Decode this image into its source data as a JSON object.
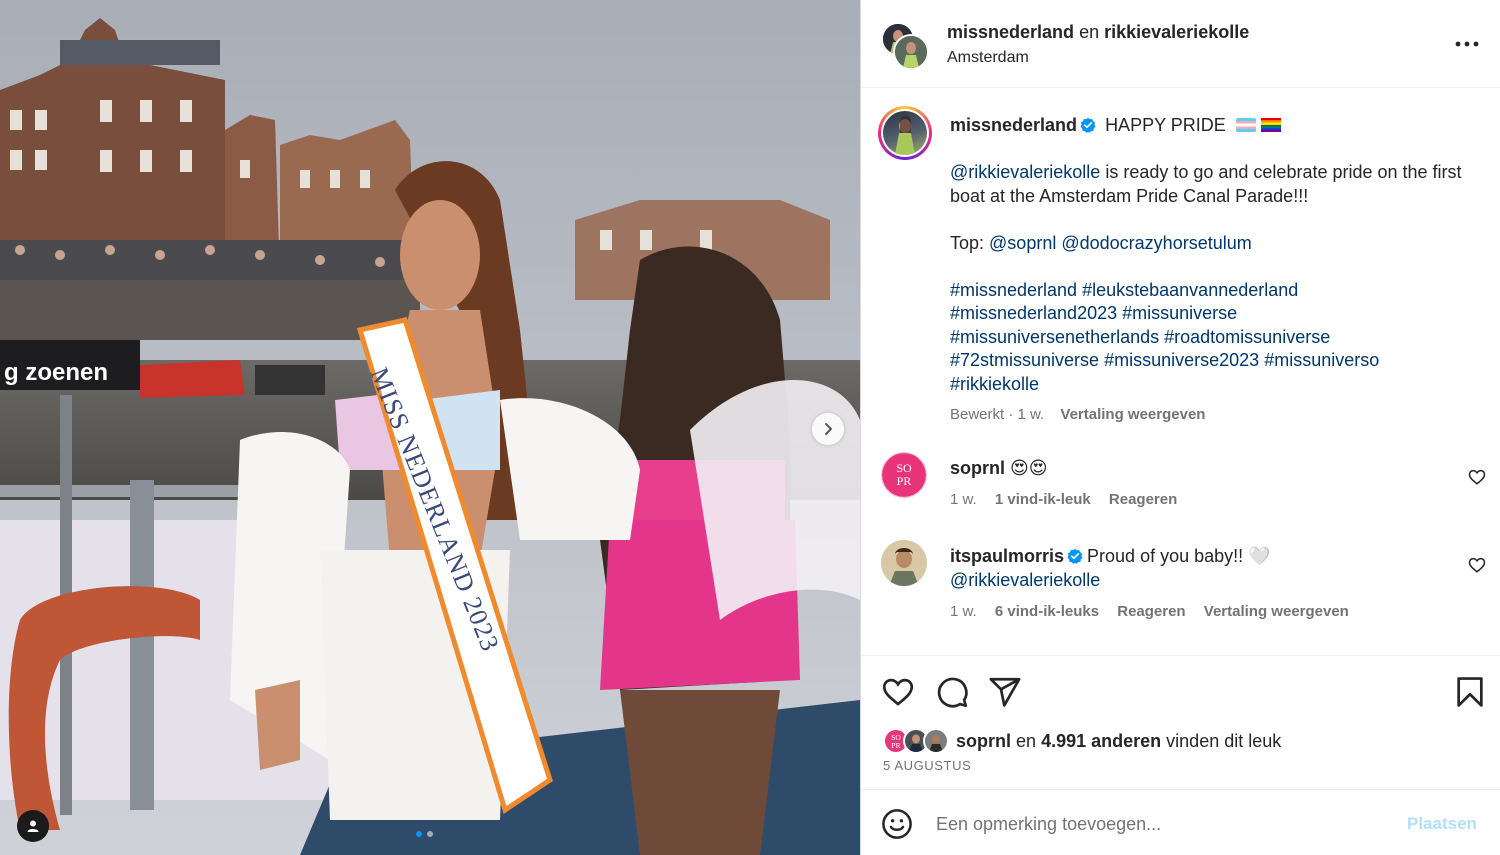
{
  "photo": {
    "sash_text": "MISS NEDERLAND 2023",
    "banner_text": "g zoenen",
    "carousel_dots": 2,
    "active_dot": 0
  },
  "header": {
    "account": "missnederland",
    "conjunction": "en",
    "collaborator": "rikkievaleriekolle",
    "location": "Amsterdam"
  },
  "caption": {
    "username": "missnederland",
    "title": "HAPPY PRIDE",
    "mention": "@rikkievaleriekolle",
    "line1_rest": " is ready to go and celebrate pride on the first boat at the Amsterdam Pride Canal Parade!!!",
    "top_label": "Top: ",
    "top_mention1": "@soprnl",
    "top_mention2": "@dodocrazyhorsetulum",
    "hashtags": [
      "#missnederland",
      "#leukstebaanvannederland",
      "#missnederland2023",
      "#missuniverse",
      "#missuniversenetherlands",
      "#roadtomissuniverse",
      "#72stmissuniverse",
      "#missuniverse2023",
      "#missuniverso",
      "#rikkiekolle"
    ],
    "edited": "Bewerkt",
    "time": "1 w.",
    "translate": "Vertaling weergeven"
  },
  "comments": [
    {
      "username": "soprnl",
      "text": "😍😍",
      "time": "1 w.",
      "likes": "1 vind-ik-leuk",
      "reply": "Reageren",
      "avatar_text": "SO PR"
    },
    {
      "username": "itspaulmorris",
      "text": "Proud of you baby!! 🤍",
      "mention": "@rikkievaleriekolle",
      "time": "1 w.",
      "likes": "6 vind-ik-leuks",
      "reply": "Reageren",
      "translate": "Vertaling weergeven"
    }
  ],
  "likes": {
    "first_user": "soprnl",
    "connector": "en",
    "count_text": "4.991 anderen",
    "suffix": "vinden dit leuk",
    "avatar_text": "SO PR"
  },
  "date": "5 AUGUSTUS",
  "add_comment": {
    "placeholder": "Een opmerking toevoegen...",
    "post_label": "Plaatsen"
  },
  "icons": [
    "heart-icon",
    "comment-icon",
    "share-icon",
    "bookmark-icon",
    "emoji-icon",
    "more-icon",
    "verified-icon",
    "chevron-right-icon",
    "user-tag-icon"
  ],
  "colors": {
    "link": "#00376b",
    "verified": "#0095f6",
    "muted": "#737373",
    "post_disabled": "#b2dffc",
    "brand_pink": "#e8357a"
  }
}
